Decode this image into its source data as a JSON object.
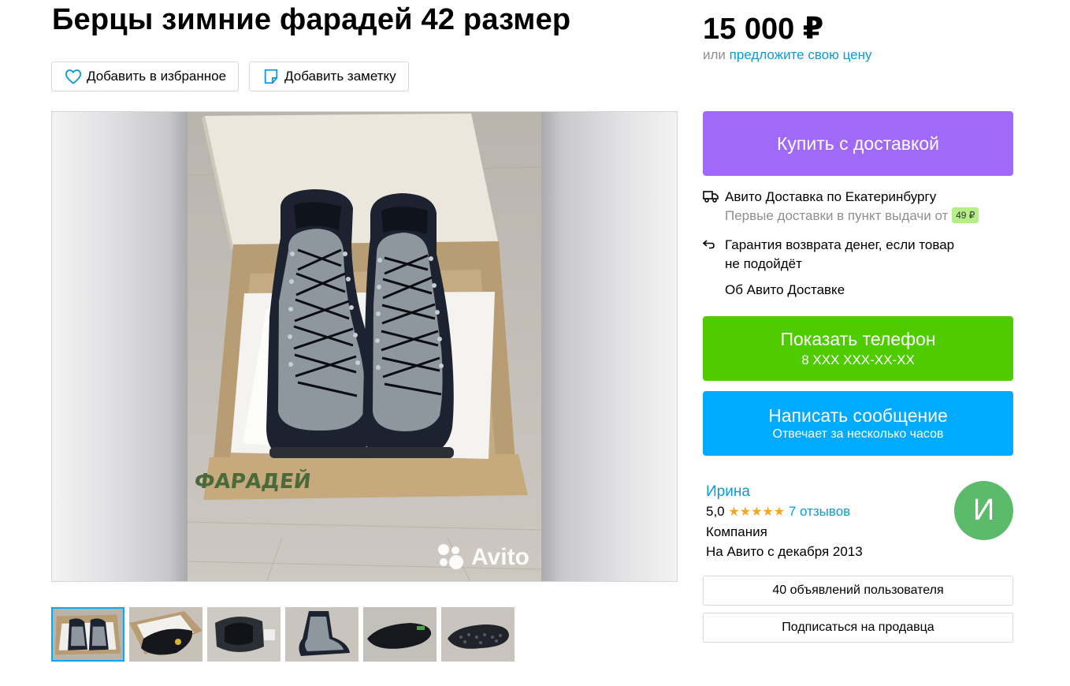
{
  "listing": {
    "title": "Берцы зимние фарадей 42 размер",
    "price": "15 000 ₽",
    "offer_prefix": "или",
    "offer_link": "предложите свою цену"
  },
  "actions": {
    "favorite": "Добавить в избранное",
    "note": "Добавить заметку"
  },
  "gallery": {
    "watermark": "Avito",
    "box_print": "ФАРАДЕЙ",
    "thumbnail_count": 6,
    "active_thumbnail": 1
  },
  "purchase": {
    "buy_label": "Купить с доставкой",
    "delivery_title": "Авито Доставка по Екатеринбургу",
    "delivery_sub": "Первые доставки в пункт выдачи от",
    "delivery_price": "49 ₽",
    "guarantee": "Гарантия возврата денег, если товар не подойдёт",
    "about_link": "Об Авито Доставке"
  },
  "contact": {
    "phone_label": "Показать телефон",
    "phone_masked": "8 XXX XXX-XX-XX",
    "message_label": "Написать сообщение",
    "message_sub": "Отвечает за несколько часов"
  },
  "seller": {
    "name": "Ирина",
    "rating": "5,0",
    "stars": "★★★★★",
    "reviews": "7 отзывов",
    "type": "Компания",
    "since": "На Авито с декабря 2013",
    "avatar_letter": "И",
    "ads_button": "40 объявлений пользователя",
    "subscribe_button": "Подписаться на продавца"
  },
  "colors": {
    "buy": "#a169f7",
    "phone": "#4fcc00",
    "message": "#00aaff",
    "link": "#0a9bd8",
    "avatar": "#5bbb6a",
    "stars": "#f5a623"
  }
}
